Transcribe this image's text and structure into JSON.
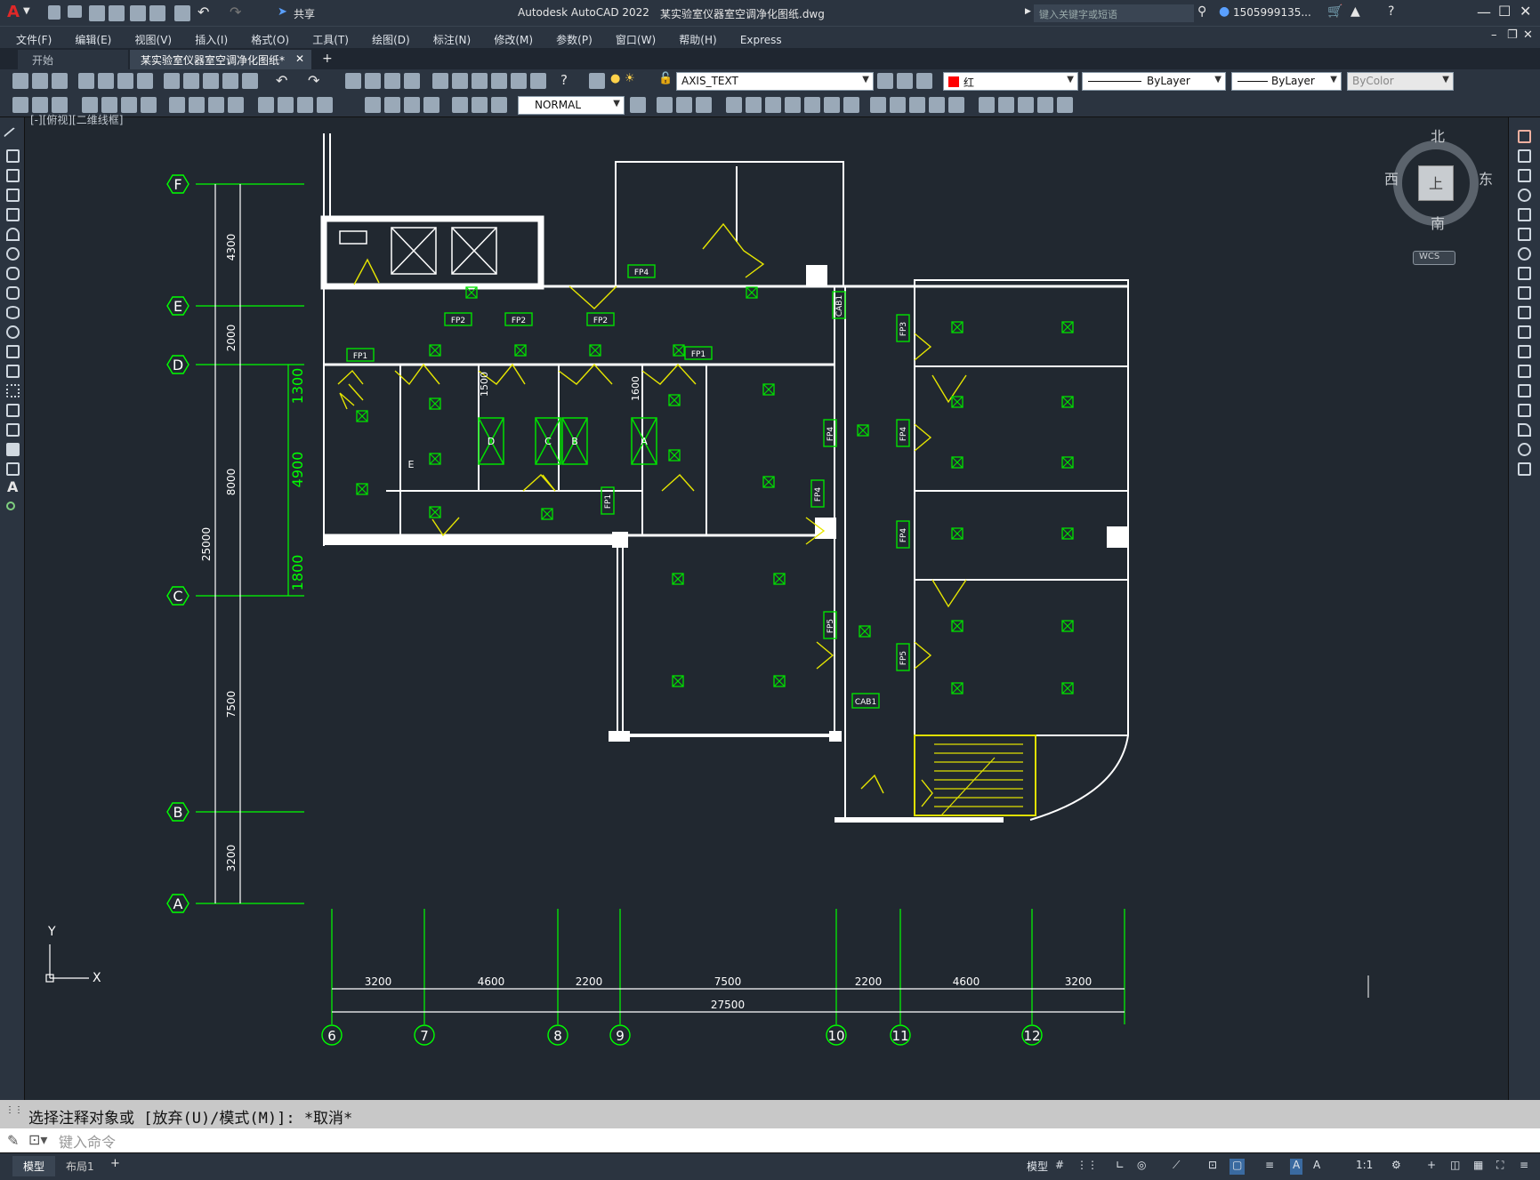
{
  "app": {
    "title": "Autodesk AutoCAD 2022",
    "file": "某实验室仪器室空调净化图纸.dwg",
    "share": "共享",
    "search_placeholder": "键入关键字或短语",
    "user": "1505999135...",
    "logo": "A"
  },
  "menu": [
    "文件(F)",
    "编辑(E)",
    "视图(V)",
    "插入(I)",
    "格式(O)",
    "工具(T)",
    "绘图(D)",
    "标注(N)",
    "修改(M)",
    "参数(P)",
    "窗口(W)",
    "帮助(H)",
    "Express"
  ],
  "tabs": [
    {
      "label": "开始",
      "active": false
    },
    {
      "label": "某实验室仪器室空调净化图纸*",
      "active": true
    }
  ],
  "toolbar": {
    "layer": "AXIS_TEXT",
    "color": "红",
    "linetype": "ByLayer",
    "lineweight": "ByLayer",
    "plotstyle": "ByColor",
    "dimstyle": "NORMAL"
  },
  "viewport_label": "[-][俯视][二维线框]",
  "viewcube": {
    "north": "北",
    "south": "南",
    "east": "东",
    "west": "西",
    "top": "上",
    "wcs": "WCS"
  },
  "drawing": {
    "grid_rows": [
      {
        "label": "F"
      },
      {
        "label": "E"
      },
      {
        "label": "D"
      },
      {
        "label": "C"
      },
      {
        "label": "B"
      },
      {
        "label": "A"
      }
    ],
    "row_dims": [
      "4300",
      "2000",
      "8000",
      "7500",
      "3200"
    ],
    "row_total": "25000",
    "row_subdims": [
      "1300",
      "4900",
      "1800"
    ],
    "grid_cols": [
      {
        "label": "6"
      },
      {
        "label": "7"
      },
      {
        "label": "8"
      },
      {
        "label": "9"
      },
      {
        "label": "10"
      },
      {
        "label": "11"
      },
      {
        "label": "12"
      }
    ],
    "col_dims": [
      "3200",
      "4600",
      "2200",
      "7500",
      "2200",
      "4600",
      "3200"
    ],
    "col_total": "27500",
    "inner_dims": [
      "1500",
      "1600"
    ],
    "fp_tags": [
      "FP4",
      "FP2",
      "FP2",
      "FP2",
      "FP1",
      "FP1",
      "FP4",
      "FP4",
      "FP4",
      "FP4",
      "FP5",
      "FP5",
      "FP3",
      "FP1"
    ],
    "cab_tags": [
      "CAB1",
      "CAB1"
    ],
    "room_letters": [
      "D",
      "C",
      "B",
      "A",
      "E"
    ],
    "axis": {
      "x": "X",
      "y": "Y"
    }
  },
  "command": {
    "history": "选择注释对象或 [放弃(U)/模式(M)]: *取消*",
    "placeholder": "键入命令"
  },
  "status": {
    "model": "模型",
    "layout": "布局1",
    "model_btn": "模型",
    "scale": "1:1"
  }
}
